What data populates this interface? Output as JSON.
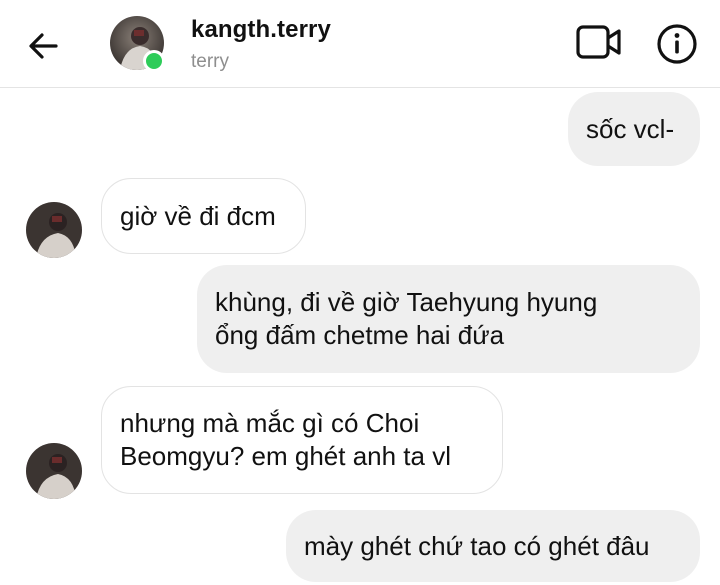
{
  "header": {
    "username": "kangth.terry",
    "subtitle": "terry",
    "back_icon": "arrow-left-icon",
    "video_icon": "video-camera-icon",
    "info_icon": "info-circle-icon",
    "online_color": "#2ecc59"
  },
  "messages": [
    {
      "direction": "sent",
      "text": "sốc vcl-"
    },
    {
      "direction": "received",
      "text": "giờ về đi đcm"
    },
    {
      "direction": "sent",
      "text": "khùng, đi về giờ Taehyung hyung\nổng đấm chetme hai đứa"
    },
    {
      "direction": "received",
      "text": "nhưng mà mắc gì có Choi\nBeomgyu? em ghét anh ta vl"
    },
    {
      "direction": "sent",
      "text": "mày ghét chứ tao có ghét đâu"
    }
  ],
  "colors": {
    "sent_bubble": "#efefef",
    "received_border": "#e3e3e3",
    "subtitle": "#8e8e8e"
  }
}
